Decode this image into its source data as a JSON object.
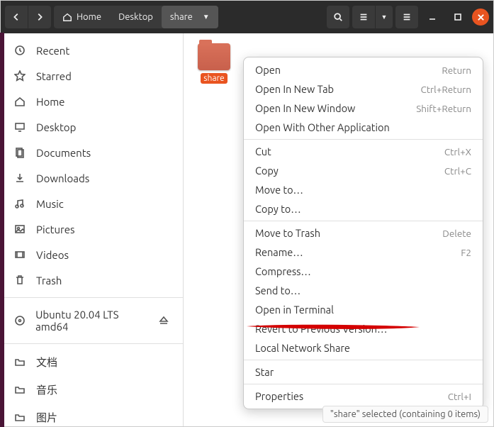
{
  "titlebar": {
    "path": {
      "home": "Home",
      "desktop": "Desktop",
      "share": "share"
    }
  },
  "sidebar": {
    "recent": "Recent",
    "starred": "Starred",
    "home": "Home",
    "desktop": "Desktop",
    "documents": "Documents",
    "downloads": "Downloads",
    "music": "Music",
    "pictures": "Pictures",
    "videos": "Videos",
    "trash": "Trash",
    "volume": "Ubuntu 20.04 LTS amd64",
    "wendang": "文档",
    "yinyue": "音乐",
    "tupian": "图片"
  },
  "folder": {
    "label": "share"
  },
  "contextmenu": {
    "open": "Open",
    "open_accel": "Return",
    "open_tab": "Open In New Tab",
    "open_tab_accel": "Ctrl+Return",
    "open_win": "Open In New Window",
    "open_win_accel": "Shift+Return",
    "open_with": "Open With Other Application",
    "cut": "Cut",
    "cut_accel": "Ctrl+X",
    "copy": "Copy",
    "copy_accel": "Ctrl+C",
    "move_to": "Move to…",
    "copy_to": "Copy to…",
    "trash": "Move to Trash",
    "trash_accel": "Delete",
    "rename": "Rename…",
    "rename_accel": "F2",
    "compress": "Compress…",
    "send_to": "Send to…",
    "open_term": "Open in Terminal",
    "revert": "Revert to Previous Version…",
    "lns": "Local Network Share",
    "star": "Star",
    "props": "Properties",
    "props_accel": "Ctrl+I"
  },
  "status": "\"share\" selected (containing 0 items)"
}
